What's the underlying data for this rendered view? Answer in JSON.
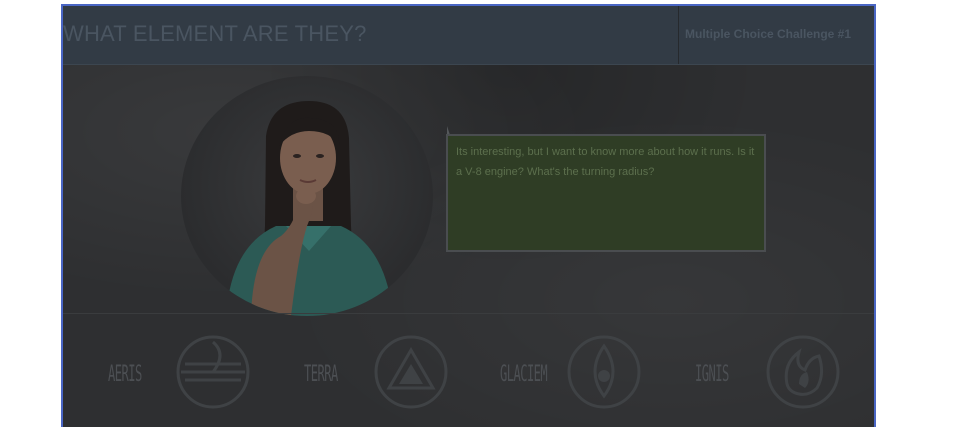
{
  "header": {
    "title": "WHAT ELEMENT ARE THEY?",
    "challenge_label": "Multiple Choice Challenge #1"
  },
  "character": {
    "dialogue": "Its interesting, but I want to know more about how it runs. Is it a V-8 engine? What's the turning radius?"
  },
  "elements": [
    {
      "label": "AERIS",
      "icon": "air-symbol-icon"
    },
    {
      "label": "TERRA",
      "icon": "earth-symbol-icon"
    },
    {
      "label": "GLACIEM",
      "icon": "water-symbol-icon"
    },
    {
      "label": "IGNIS",
      "icon": "fire-symbol-icon"
    }
  ],
  "colors": {
    "background": "#2e2f31",
    "header": "#323b45",
    "bubble": "#2f3d25",
    "frame_border": "#4a66c4"
  }
}
